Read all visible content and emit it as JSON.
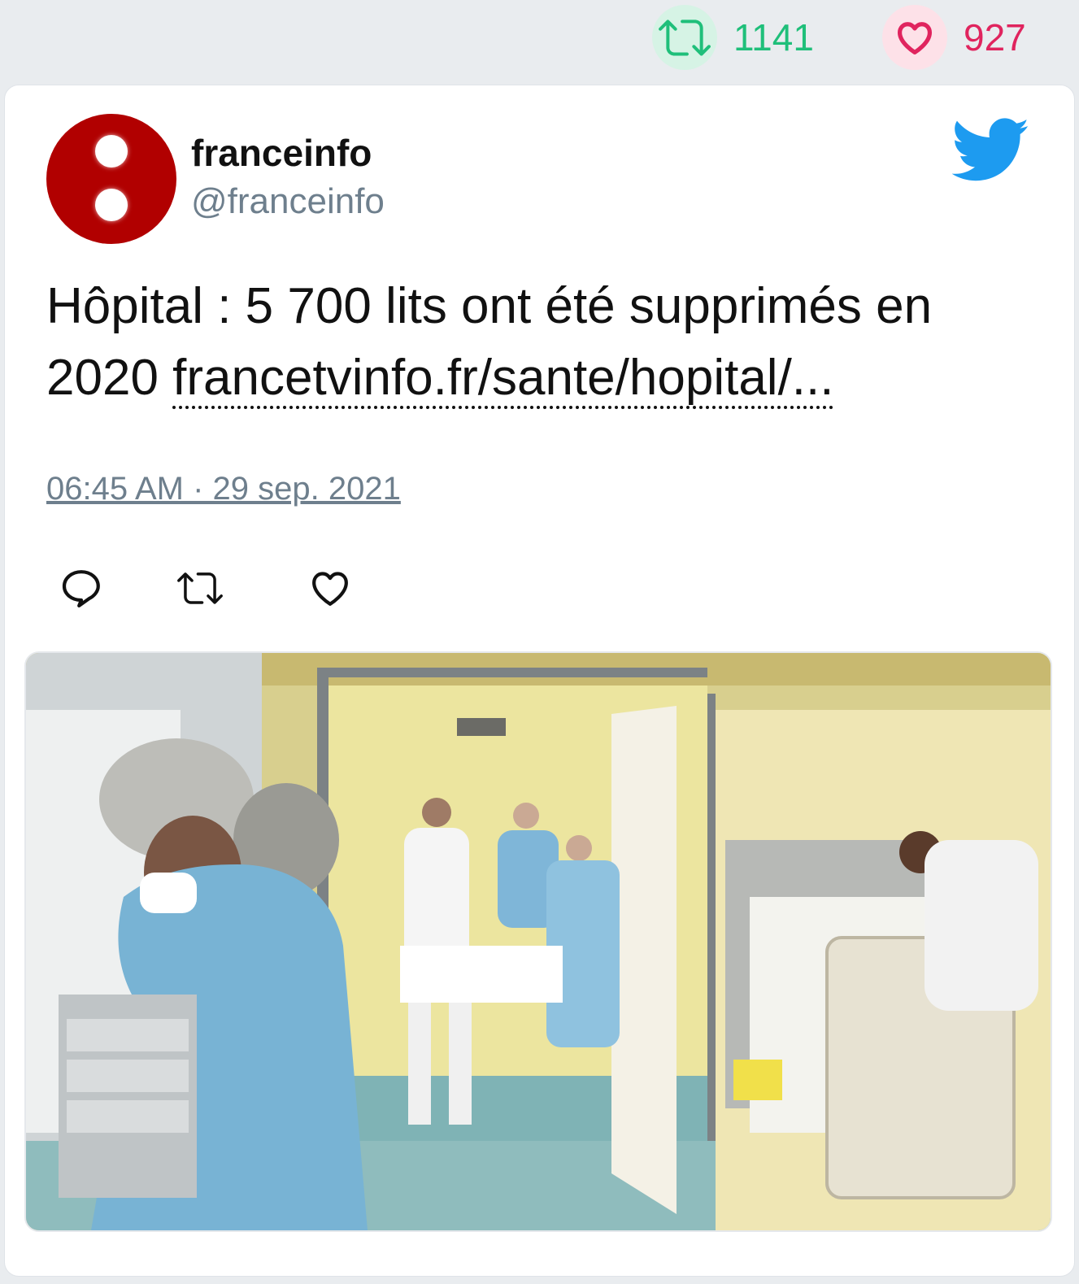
{
  "stats": {
    "retweet_count": "1141",
    "like_count": "927"
  },
  "tweet": {
    "author_name": "franceinfo",
    "author_handle": "@franceinfo",
    "text_prefix": "Hôpital : 5 700 lits ont été supprimés en 2020 ",
    "link_text": "francetvinfo.fr/sante/hopital/...",
    "timestamp": "06:45 AM · 29 sep. 2021"
  },
  "icons": {
    "retweet_stat": "retweet-icon",
    "like_stat": "heart-icon",
    "brand": "twitter-bird-icon",
    "reply": "reply-icon",
    "retweet": "retweet-icon",
    "like": "heart-icon"
  },
  "colors": {
    "retweet": "#1fbf7a",
    "like": "#e0245e",
    "twitter_blue": "#1d9bf0",
    "avatar_red": "#b10000"
  },
  "photo": {
    "subject": "hospital-ward-photo"
  }
}
